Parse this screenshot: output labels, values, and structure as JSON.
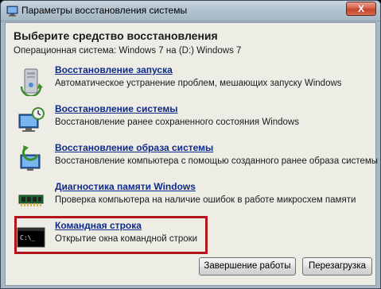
{
  "window": {
    "title": "Параметры восстановления системы",
    "close_label": "X"
  },
  "header": {
    "title": "Выберите средство восстановления",
    "os_line": "Операционная система: Windows 7 на (D:) Windows 7"
  },
  "tools": [
    {
      "name": "Восстановление запуска",
      "description": "Автоматическое устранение проблем, мешающих запуску Windows",
      "icon": "startup-repair-icon"
    },
    {
      "name": "Восстановление системы",
      "description": "Восстановление ранее сохраненного состояния Windows",
      "icon": "system-restore-icon"
    },
    {
      "name": "Восстановление образа системы",
      "description": "Восстановление компьютера с помощью  созданного ранее образа системы",
      "icon": "system-image-icon"
    },
    {
      "name": "Диагностика памяти Windows",
      "description": "Проверка компьютера на наличие ошибок в работе микросхем памяти",
      "icon": "memory-diagnostic-icon"
    },
    {
      "name": "Командная строка",
      "description": "Открытие окна командной строки",
      "icon": "command-prompt-icon",
      "highlighted": true
    }
  ],
  "buttons": {
    "shutdown": "Завершение работы",
    "restart": "Перезагрузка"
  },
  "colors": {
    "link": "#0e2a8a",
    "highlight": "#b3151b",
    "client_bg": "#eeede5",
    "titlebar": "#b3c3cf"
  }
}
